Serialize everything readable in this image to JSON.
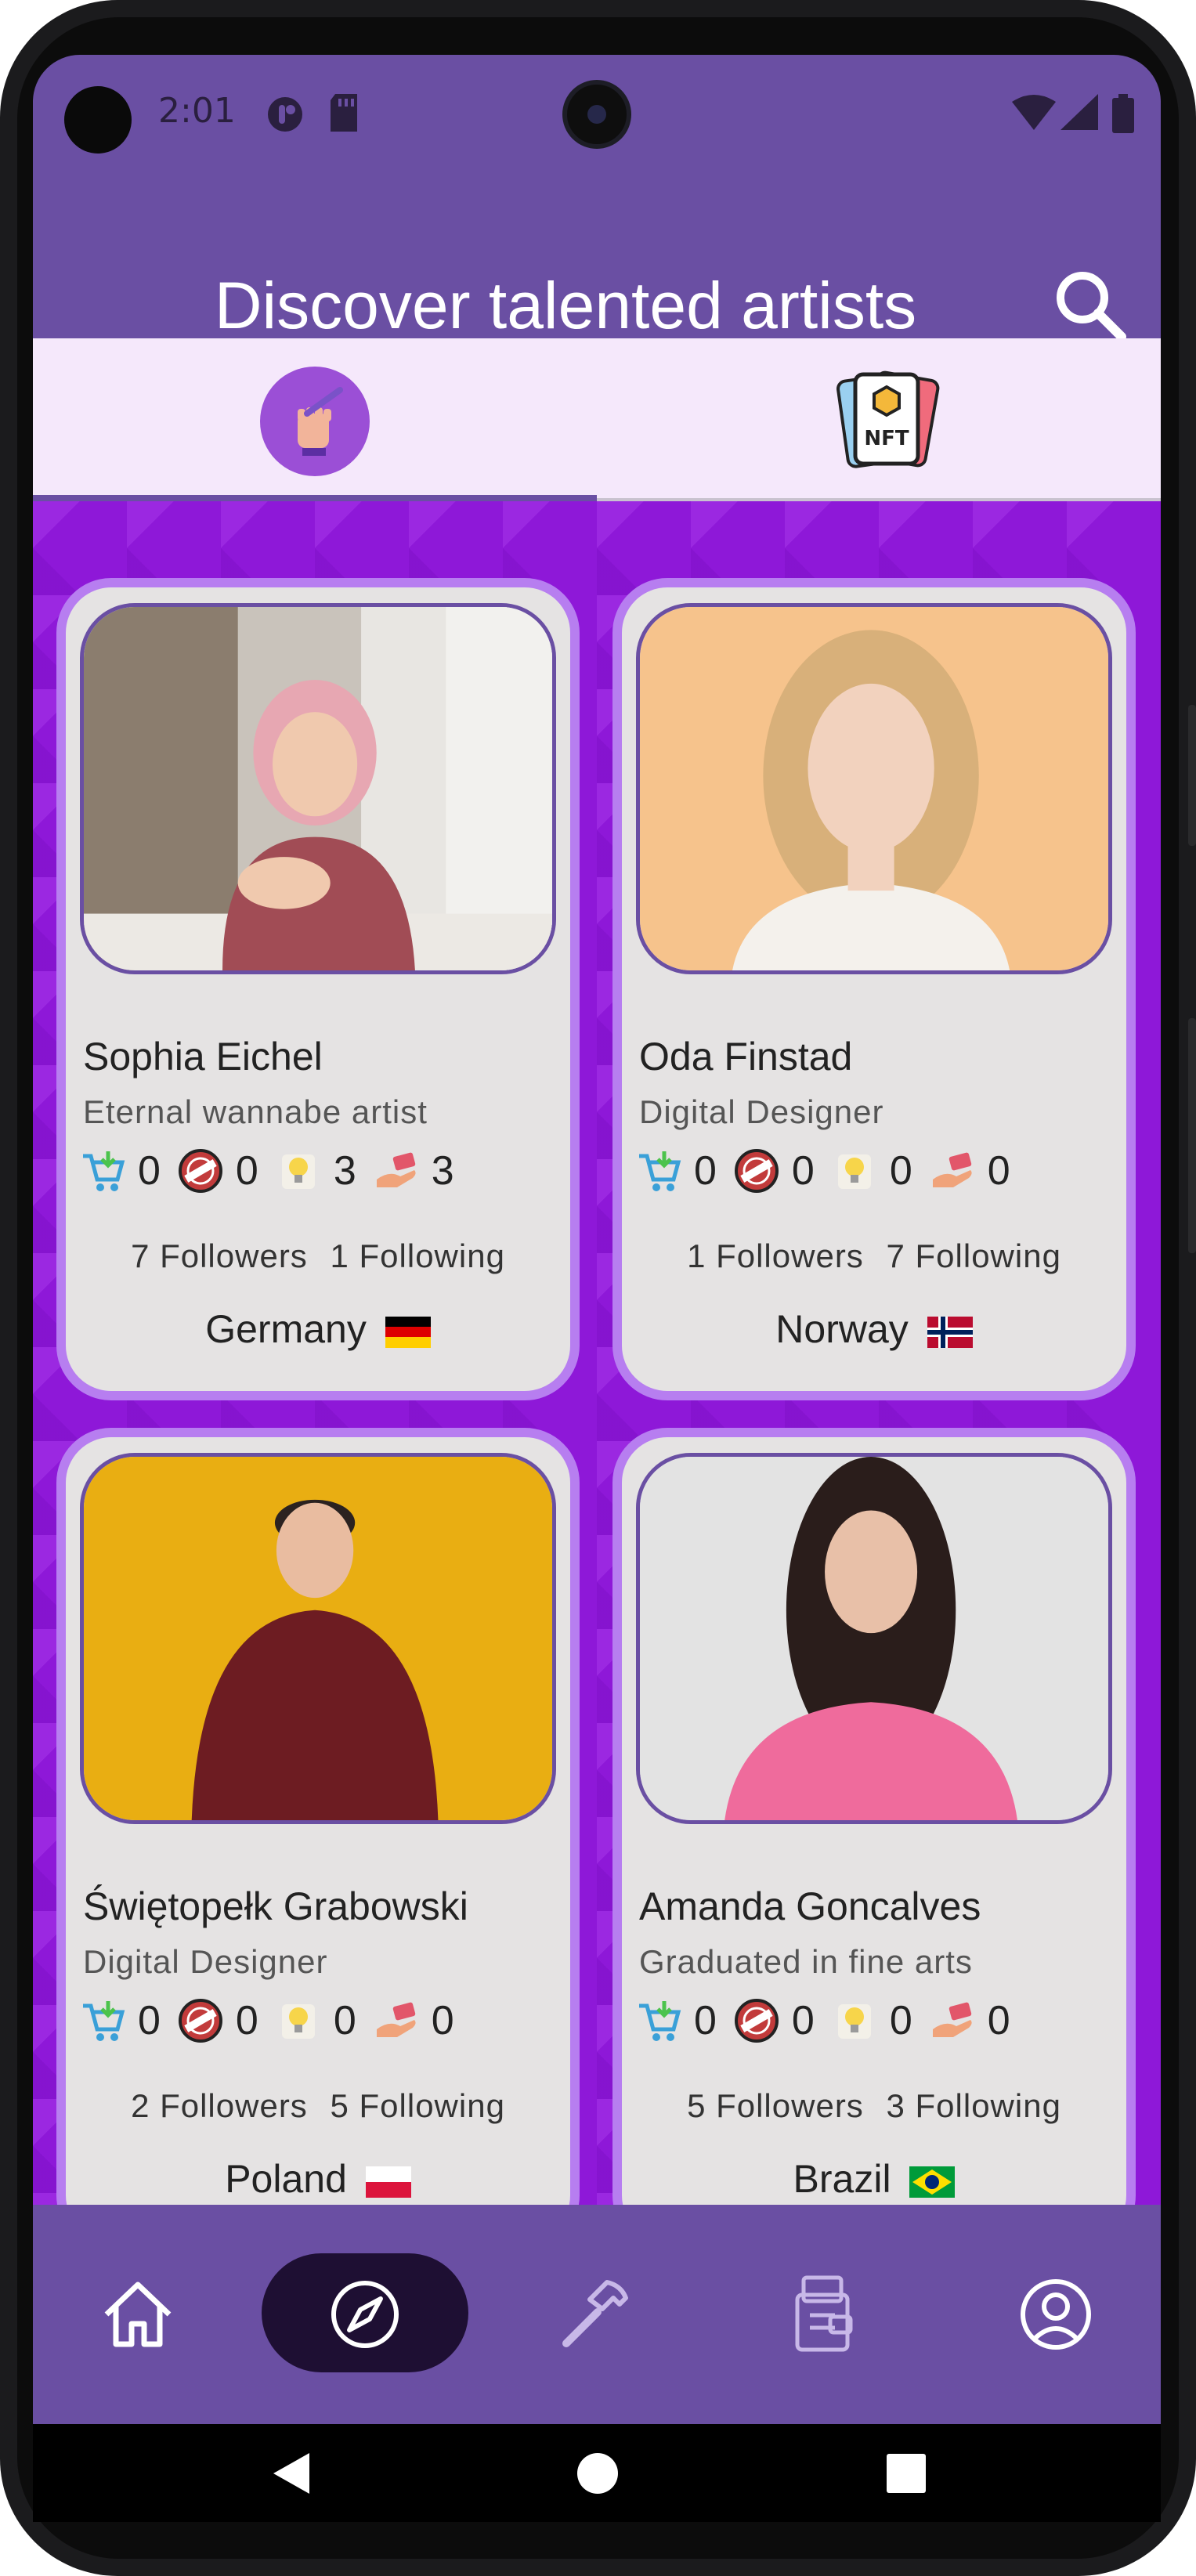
{
  "status_bar": {
    "time": "2:01",
    "icons": [
      "privacy-icon",
      "sd-card-icon",
      "wifi-icon",
      "signal-icon",
      "battery-icon"
    ]
  },
  "header": {
    "title": "Discover talented artists",
    "search_icon": "search-icon"
  },
  "tabs": [
    {
      "name": "artists",
      "icon": "artist-fist-brush-icon",
      "active": true
    },
    {
      "name": "nft",
      "icon": "nft-cards-icon",
      "active": false
    }
  ],
  "stat_icons": [
    "shopping-cart-icon",
    "sold-badge-icon",
    "idea-bulb-icon",
    "offer-hand-icon"
  ],
  "artists": [
    {
      "name": "Sophia Eichel",
      "title": "Eternal wannabe artist",
      "stats": [
        "0",
        "0",
        "3",
        "3"
      ],
      "followers": "7 Followers",
      "following": "1 Following",
      "country": "Germany"
    },
    {
      "name": "Oda Finstad",
      "title": "Digital Designer",
      "stats": [
        "0",
        "0",
        "0",
        "0"
      ],
      "followers": "1 Followers",
      "following": "7 Following",
      "country": "Norway"
    },
    {
      "name": "Świętopełk Grabowski",
      "title": "Digital Designer",
      "stats": [
        "0",
        "0",
        "0",
        "0"
      ],
      "followers": "2 Followers",
      "following": "5 Following",
      "country": "Poland"
    },
    {
      "name": "Amanda Goncalves",
      "title": "Graduated in fine arts",
      "stats": [
        "0",
        "0",
        "0",
        "0"
      ],
      "followers": "5 Followers",
      "following": "3 Following",
      "country": "Brazil"
    }
  ],
  "bottom_nav": [
    {
      "name": "home",
      "icon": "home-icon",
      "active": false
    },
    {
      "name": "discover",
      "icon": "compass-icon",
      "active": true
    },
    {
      "name": "create",
      "icon": "hammer-icon",
      "active": false
    },
    {
      "name": "nft-wallet",
      "icon": "nft-wallet-icon",
      "active": false
    },
    {
      "name": "profile",
      "icon": "profile-icon",
      "active": false
    }
  ],
  "colors": {
    "primary": "#6a4fa3",
    "content_bg": "#8e18d8",
    "card_border": "#b77ef0",
    "card_bg": "#e5e3e3",
    "active_nav": "#1e0f33"
  }
}
